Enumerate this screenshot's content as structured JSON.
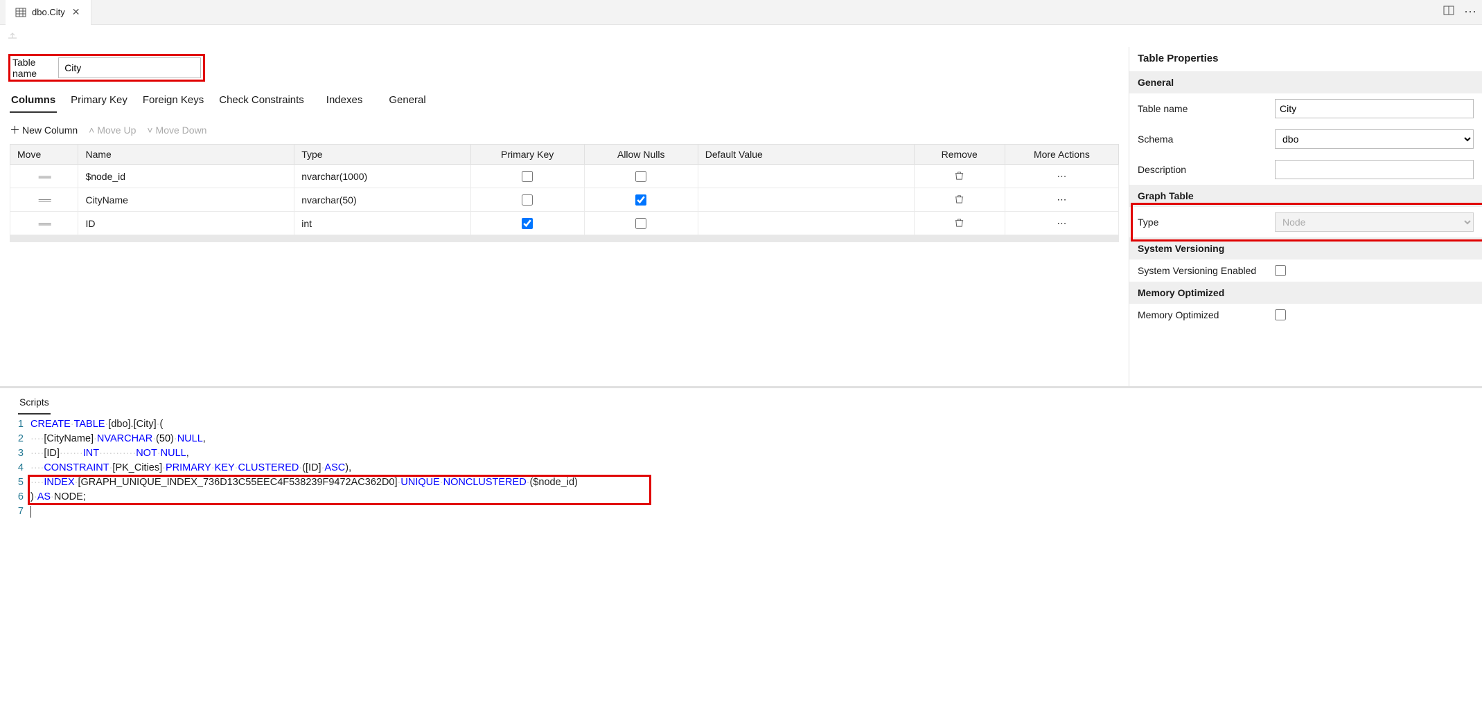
{
  "tab": {
    "title": "dbo.City"
  },
  "designer": {
    "table_name_label": "Table name",
    "table_name_value": "City",
    "subtabs": [
      "Columns",
      "Primary Key",
      "Foreign Keys",
      "Check Constraints",
      "Indexes",
      "General"
    ],
    "active_subtab": 0,
    "col_toolbar": {
      "new_column": "New Column",
      "move_up": "Move Up",
      "move_down": "Move Down"
    },
    "headers": {
      "move": "Move",
      "name": "Name",
      "type": "Type",
      "pk": "Primary Key",
      "nulls": "Allow Nulls",
      "def": "Default Value",
      "remove": "Remove",
      "more": "More Actions"
    },
    "rows": [
      {
        "name": "$node_id",
        "type": "nvarchar(1000)",
        "pk": false,
        "nulls": false,
        "def": ""
      },
      {
        "name": "CityName",
        "type": "nvarchar(50)",
        "pk": false,
        "nulls": true,
        "def": ""
      },
      {
        "name": "ID",
        "type": "int",
        "pk": true,
        "nulls": false,
        "def": ""
      }
    ]
  },
  "properties": {
    "title": "Table Properties",
    "sections": {
      "general": "General",
      "graph_table": "Graph Table",
      "system_versioning": "System Versioning",
      "memory_optimized": "Memory Optimized"
    },
    "labels": {
      "table_name": "Table name",
      "schema": "Schema",
      "description": "Description",
      "type": "Type",
      "sv_enabled": "System Versioning Enabled",
      "mem_opt": "Memory Optimized"
    },
    "values": {
      "table_name": "City",
      "schema": "dbo",
      "description": "",
      "type": "Node",
      "sv_enabled": false,
      "mem_opt": false
    }
  },
  "scripts": {
    "title": "Scripts",
    "index_name": "GRAPH_UNIQUE_INDEX_736D13C55EEC4F538239F9472AC362D0"
  }
}
